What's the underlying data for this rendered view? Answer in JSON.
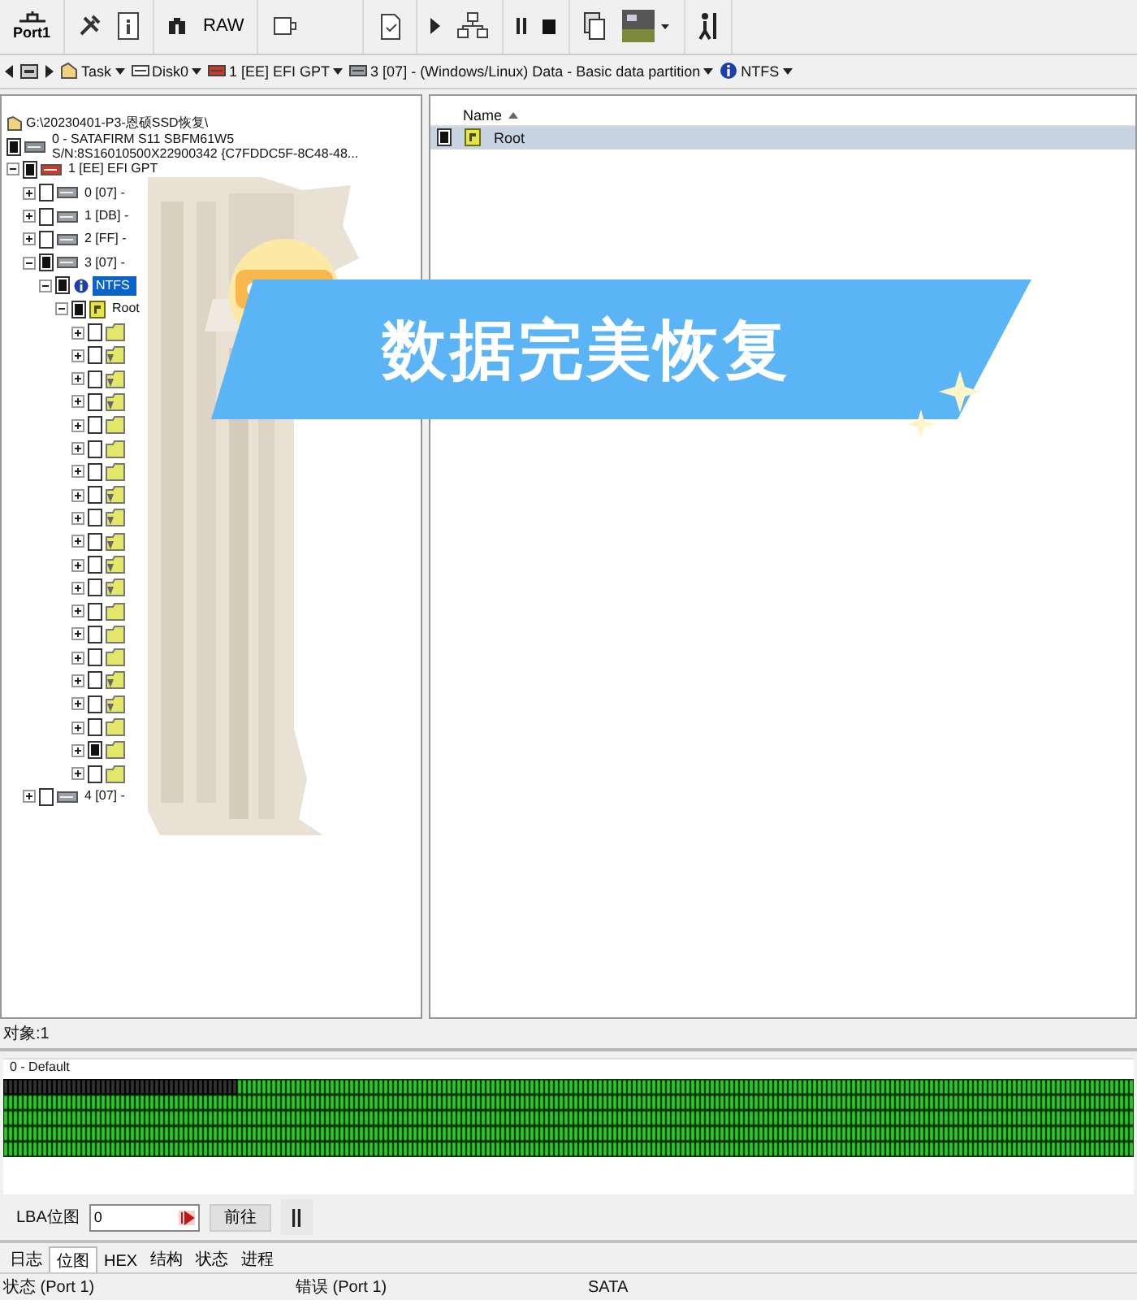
{
  "toolbar": {
    "port_label": "Port1",
    "raw_label": "RAW"
  },
  "breadcrumb": [
    {
      "kind": "task",
      "label": "Task"
    },
    {
      "kind": "disk",
      "label": "Disk0"
    },
    {
      "kind": "gpt",
      "label": "1 [EE] EFI GPT"
    },
    {
      "kind": "partition",
      "label": "3 [07] - (Windows/Linux) Data - Basic data partition"
    },
    {
      "kind": "fs",
      "label": "NTFS"
    }
  ],
  "tree": {
    "path": "G:\\20230401-P3-恩硕SSD恢复\\",
    "nodes": [
      {
        "kind": "disk",
        "label": "0 - SATAFIRM   S11 SBFM61W5 S/N:8S16010500X22900342 {C7FDDC5F-8C48-48...",
        "checked": true,
        "selected": false,
        "children": [
          {
            "kind": "gpt",
            "label": "1 [EE] EFI GPT",
            "checked": true,
            "selected": false,
            "expanded": true,
            "children": [
              {
                "kind": "partition",
                "label": "0 [07] -",
                "checked": false,
                "selected": false,
                "expanded": false
              },
              {
                "kind": "partition",
                "label": "1 [DB] -",
                "checked": false,
                "selected": false,
                "expanded": false
              },
              {
                "kind": "partition",
                "label": "2 [FF] -",
                "checked": false,
                "selected": false,
                "expanded": false
              },
              {
                "kind": "partition",
                "label": "3 [07] -",
                "checked": true,
                "selected": false,
                "expanded": true,
                "children": [
                  {
                    "kind": "fs",
                    "label": "NTFS",
                    "checked": true,
                    "selected": true,
                    "expanded": true,
                    "children": [
                      {
                        "kind": "root",
                        "label": "Root",
                        "checked": true,
                        "selected": false,
                        "expanded": true,
                        "children": [
                          {
                            "kind": "folder",
                            "checked": false,
                            "selected": false,
                            "expanded": false
                          },
                          {
                            "kind": "folder-marked",
                            "checked": false,
                            "selected": false,
                            "expanded": false
                          },
                          {
                            "kind": "folder-marked",
                            "checked": false,
                            "selected": false,
                            "expanded": false
                          },
                          {
                            "kind": "folder-marked",
                            "checked": false,
                            "selected": false,
                            "expanded": false
                          },
                          {
                            "kind": "folder",
                            "checked": false,
                            "selected": false,
                            "expanded": false
                          },
                          {
                            "kind": "folder",
                            "checked": false,
                            "selected": false,
                            "expanded": false
                          },
                          {
                            "kind": "folder",
                            "checked": false,
                            "selected": false,
                            "expanded": false
                          },
                          {
                            "kind": "folder-marked",
                            "checked": false,
                            "selected": false,
                            "expanded": false
                          },
                          {
                            "kind": "folder-marked",
                            "checked": false,
                            "selected": false,
                            "expanded": false
                          },
                          {
                            "kind": "folder-marked",
                            "checked": false,
                            "selected": false,
                            "expanded": false
                          },
                          {
                            "kind": "folder-marked",
                            "checked": false,
                            "selected": false,
                            "expanded": false
                          },
                          {
                            "kind": "folder-marked",
                            "checked": false,
                            "selected": false,
                            "expanded": false
                          },
                          {
                            "kind": "folder",
                            "checked": false,
                            "selected": false,
                            "expanded": false
                          },
                          {
                            "kind": "folder",
                            "checked": false,
                            "selected": false,
                            "expanded": false
                          },
                          {
                            "kind": "folder",
                            "checked": false,
                            "selected": false,
                            "expanded": false
                          },
                          {
                            "kind": "folder-marked",
                            "checked": false,
                            "selected": false,
                            "expanded": false
                          },
                          {
                            "kind": "folder-marked",
                            "checked": false,
                            "selected": false,
                            "expanded": false
                          },
                          {
                            "kind": "folder",
                            "checked": false,
                            "selected": false,
                            "expanded": false
                          },
                          {
                            "kind": "folder",
                            "checked": true,
                            "selected": false,
                            "expanded": false
                          },
                          {
                            "kind": "folder",
                            "checked": false,
                            "selected": false,
                            "expanded": false
                          }
                        ]
                      }
                    ]
                  }
                ]
              },
              {
                "kind": "partition",
                "label": "4 [07] -",
                "checked": false,
                "selected": false,
                "expanded": false
              }
            ]
          }
        ]
      }
    ]
  },
  "file_list": {
    "column": "Name",
    "rows": [
      {
        "label": "Root",
        "checked": true,
        "selected": true
      }
    ]
  },
  "object_count": "对象:1",
  "bitmap": {
    "title": "0 - Default"
  },
  "lba": {
    "label": "LBA位图",
    "value": "0",
    "go_button": "前往"
  },
  "tabs": [
    {
      "label": "日志",
      "selected": false
    },
    {
      "label": "位图",
      "selected": true
    },
    {
      "label": "HEX",
      "selected": false
    },
    {
      "label": "结构",
      "selected": false
    },
    {
      "label": "状态",
      "selected": false
    },
    {
      "label": "进程",
      "selected": false
    }
  ],
  "status_bar": [
    "状态 (Port 1)",
    "错误 (Port 1)",
    "SATA"
  ],
  "overlay": {
    "banner": "数据完美恢复"
  }
}
